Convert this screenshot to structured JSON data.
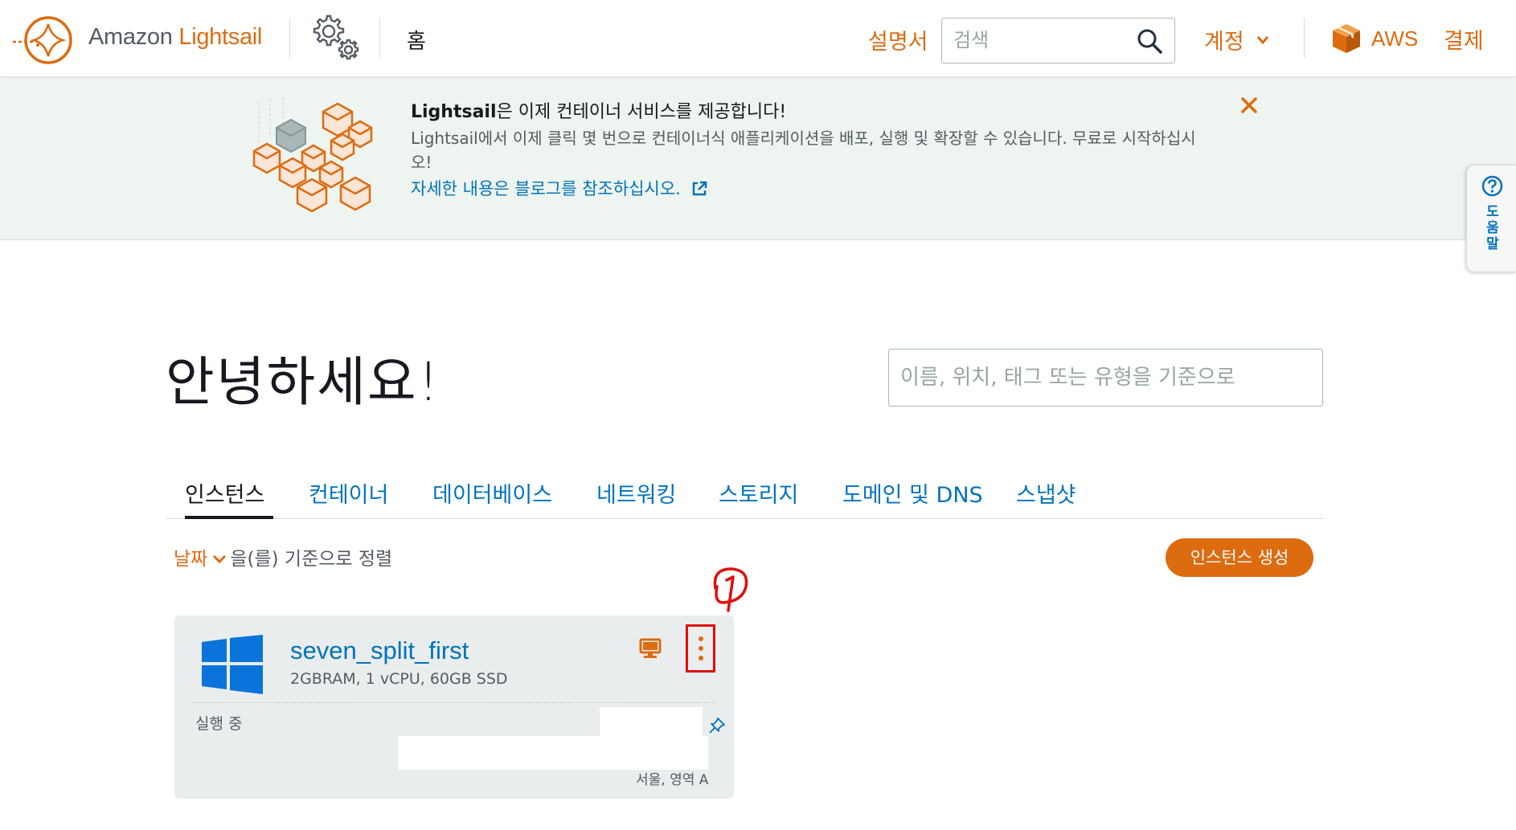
{
  "header": {
    "brand_prefix": "Amazon",
    "brand_name": "Lightsail",
    "home_label": "홈",
    "docs_label": "설명서",
    "search_placeholder": "검색",
    "account_label": "계정",
    "aws_label": "AWS",
    "billing_label": "결제"
  },
  "banner": {
    "title_bold": "Lightsail",
    "title_rest": "은 이제 컨테이너 서비스를 제공합니다!",
    "body": "Lightsail에서 이제 클릭 몇 번으로 컨테이너식 애플리케이션을 배포, 실행 및 확장할 수 있습니다. 무료로 시작하십시오!",
    "link": "자세한 내용은 블로그를 참조하십시오."
  },
  "help": {
    "label": "도움말"
  },
  "main": {
    "greeting": "안녕하세요!",
    "filter_placeholder": "이름, 위치, 태그 또는 유형을 기준으로",
    "tabs": [
      {
        "label": "인스턴스",
        "active": true
      },
      {
        "label": "컨테이너",
        "active": false
      },
      {
        "label": "데이터베이스",
        "active": false
      },
      {
        "label": "네트워킹",
        "active": false
      },
      {
        "label": "스토리지",
        "active": false
      },
      {
        "label": "도메인 및 DNS",
        "active": false
      },
      {
        "label": "스냅샷",
        "active": false
      }
    ],
    "sort_key": "날짜",
    "sort_suffix": "을(를) 기준으로 정렬",
    "create_button": "인스턴스 생성"
  },
  "instance": {
    "name": "seven_split_first",
    "spec": "2GBRAM, 1 vCPU, 60GB SSD",
    "status": "실행 중",
    "region": "서울, 영역 A",
    "os_icon": "windows-logo-icon"
  },
  "colors": {
    "accent": "#dd6b10",
    "link": "#0073bb",
    "banner_bg": "#eef4ef",
    "card_bg": "#eaeded",
    "annotation_red": "#e00d0d"
  }
}
